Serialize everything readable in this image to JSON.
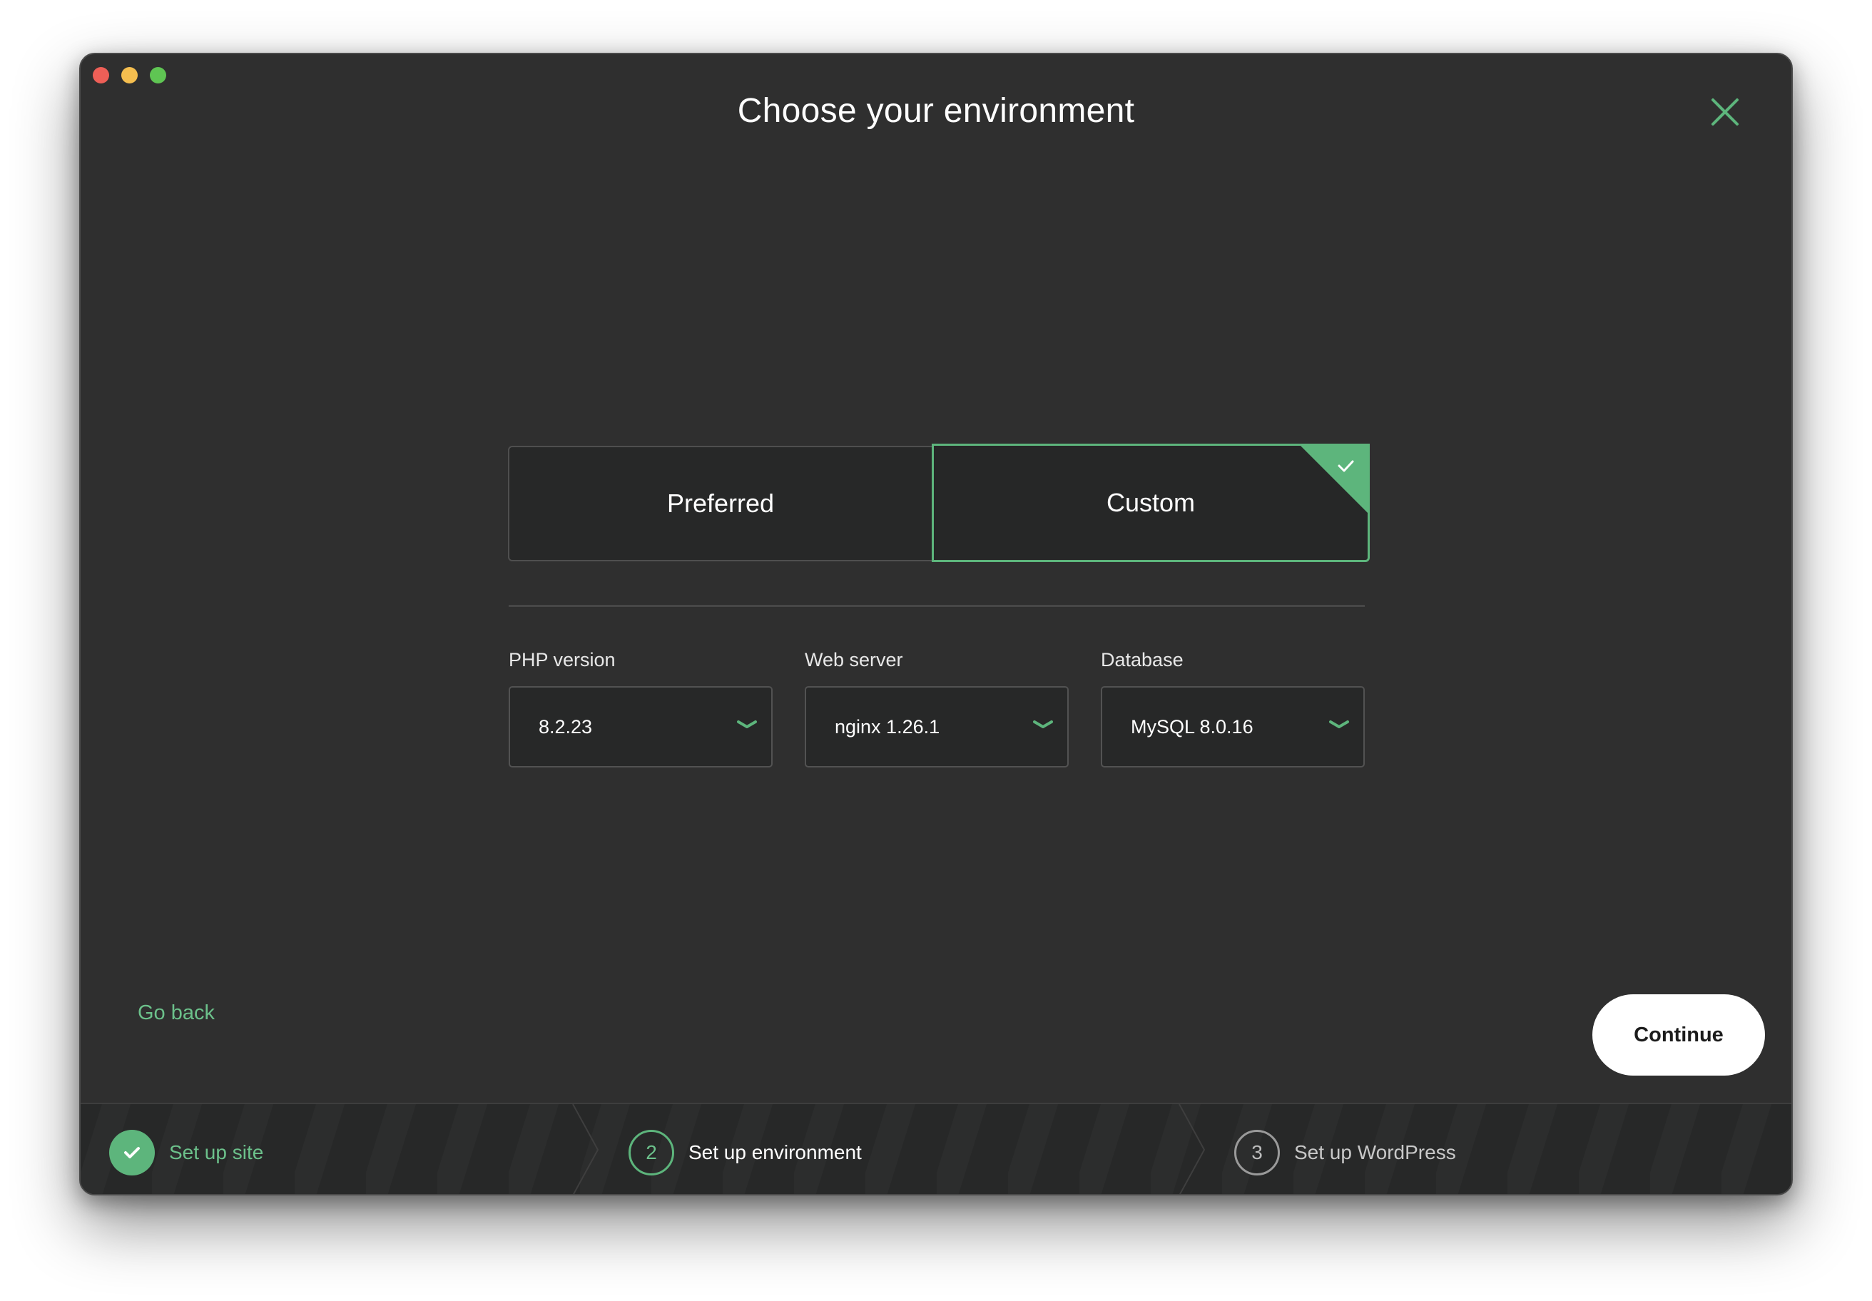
{
  "window": {
    "title": "Choose your environment"
  },
  "environment_toggle": {
    "options": [
      {
        "label": "Preferred",
        "selected": false
      },
      {
        "label": "Custom",
        "selected": true
      }
    ]
  },
  "fields": [
    {
      "label": "PHP version",
      "value": "8.2.23"
    },
    {
      "label": "Web server",
      "value": "nginx 1.26.1"
    },
    {
      "label": "Database",
      "value": "MySQL 8.0.16"
    }
  ],
  "footer": {
    "back_label": "Go back",
    "continue_label": "Continue"
  },
  "steps": [
    {
      "number": "1",
      "label": "Set up site",
      "state": "complete"
    },
    {
      "number": "2",
      "label": "Set up environment",
      "state": "current"
    },
    {
      "number": "3",
      "label": "Set up WordPress",
      "state": "upcoming"
    }
  ],
  "colors": {
    "accent": "#5db57c",
    "background": "#2f2f2f",
    "panel": "#272828"
  }
}
